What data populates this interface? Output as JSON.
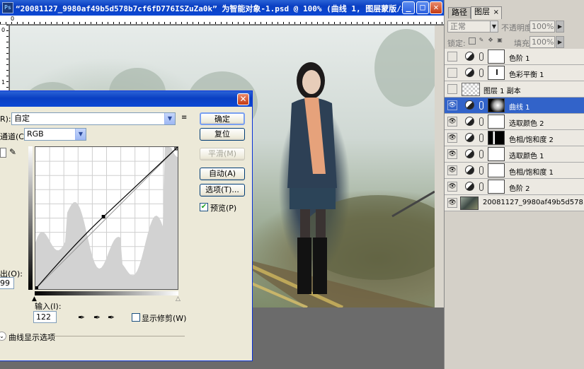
{
  "window": {
    "title": "“20081127_9980af49b5d578b7cf6fD776ISZuZa0k” 为智能对象-1.psd @ 100% (曲线 1, 图层蒙版/8)",
    "app_icon": "Ps",
    "min_label": "_",
    "max_label": "□",
    "close_label": "✕"
  },
  "rulers": {
    "top_zero": "0",
    "left_zero": "0",
    "left_one": "1"
  },
  "panel": {
    "tabs": [
      "路径",
      "图层"
    ],
    "tab_close": "×",
    "blend_mode": "正常",
    "opacity_label": "不透明度:",
    "opacity_value": "100%",
    "lock_label": "锁定:",
    "fill_label": "填充:",
    "fill_value": "100%",
    "layers": [
      {
        "name": "色阶 1",
        "visible": false,
        "type": "adjust"
      },
      {
        "name": "色彩平衡 1",
        "visible": false,
        "type": "adjust"
      },
      {
        "name": "图层 1 副本",
        "visible": false,
        "type": "pixel"
      },
      {
        "name": "曲线 1",
        "visible": true,
        "type": "adjust",
        "selected": true
      },
      {
        "name": "选取颜色 2",
        "visible": true,
        "type": "adjust"
      },
      {
        "name": "色相/饱和度 2",
        "visible": true,
        "type": "adjust"
      },
      {
        "name": "选取颜色 1",
        "visible": true,
        "type": "adjust"
      },
      {
        "name": "色相/饱和度 1",
        "visible": true,
        "type": "adjust"
      },
      {
        "name": "色阶 2",
        "visible": true,
        "type": "adjust"
      },
      {
        "name": "20081127_9980af49b5d578...",
        "visible": true,
        "type": "image"
      }
    ]
  },
  "curves_dialog": {
    "close_label": "✕",
    "preset_label": "R):",
    "preset_value": "自定",
    "channel_label": "通道(C):",
    "channel_value": "RGB",
    "output_label": "出(O):",
    "output_value": "99",
    "input_label": "输入(I):",
    "input_value": "122",
    "ok_label": "确定",
    "reset_label": "复位",
    "smooth_label": "平滑(M)",
    "auto_label": "自动(A)",
    "options_label": "选项(T)...",
    "preview_label": "预览(P)",
    "preview_checked": true,
    "show_clipping_label": "显示修剪(W)",
    "show_clipping_checked": false,
    "display_options_label": "曲线显示选项",
    "curve_point": {
      "input": 122,
      "output": 130
    }
  }
}
